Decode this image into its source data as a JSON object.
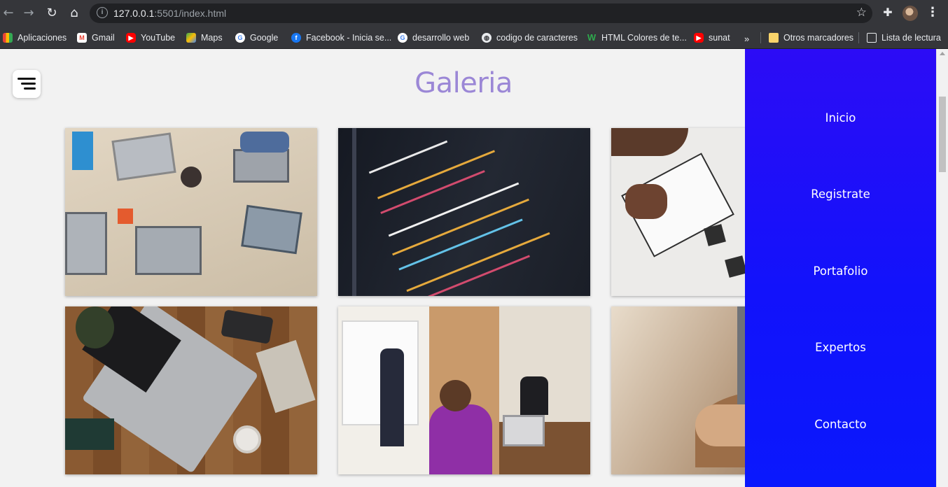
{
  "browser": {
    "url_host": "127.0.0.1",
    "url_rest": ":5501/index.html",
    "bookmarks": [
      {
        "label": "Aplicaciones",
        "icon": "apps-icon"
      },
      {
        "label": "Gmail",
        "icon": "gmail-icon"
      },
      {
        "label": "YouTube",
        "icon": "youtube-icon"
      },
      {
        "label": "Maps",
        "icon": "maps-icon"
      },
      {
        "label": "Google",
        "icon": "google-icon"
      },
      {
        "label": "Facebook - Inicia se...",
        "icon": "facebook-icon"
      },
      {
        "label": "desarrollo web",
        "icon": "google-icon"
      },
      {
        "label": "codigo de caracteres",
        "icon": "globe-icon"
      },
      {
        "label": "HTML Colores de te...",
        "icon": "w-icon"
      },
      {
        "label": "sunat",
        "icon": "youtube-icon"
      }
    ],
    "overflow_label": "»",
    "other_bookmarks": "Otros marcadores",
    "reading_list": "Lista de lectura"
  },
  "page": {
    "title": "Galeria",
    "title_color": "#9b87d6",
    "nav_color": "#1212fb",
    "nav_items": [
      "Inicio",
      "Registrate",
      "Portafolio",
      "Expertos",
      "Contacto"
    ],
    "photos": [
      {
        "name": "photo-team-desk-laptops"
      },
      {
        "name": "photo-code-screen"
      },
      {
        "name": "photo-notebook-writing"
      },
      {
        "name": "photo-laptop-wood-table"
      },
      {
        "name": "photo-whiteboard-meeting"
      },
      {
        "name": "photo-hand-on-laptop"
      }
    ]
  }
}
